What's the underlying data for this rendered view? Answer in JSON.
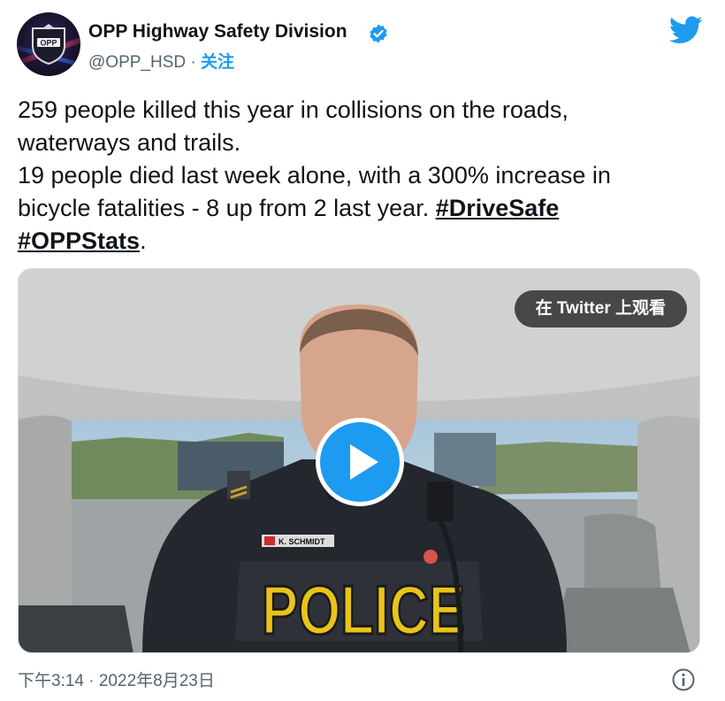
{
  "author": {
    "name": "OPP Highway Safety Division",
    "handle": "@OPP_HSD",
    "separator": "·",
    "follow_label": "关注",
    "avatar_text": "OPP"
  },
  "tweet": {
    "lines": [
      "259 people killed this year in collisions on the roads,",
      "waterways and trails.",
      "19 people died last week alone, with a 300% increase in",
      "bicycle fatalities - 8 up from 2 last year. "
    ],
    "hashtags": [
      "#DriveSafe",
      "#OPPStats"
    ],
    "trailing_period": "."
  },
  "media": {
    "watch_label": "在 Twitter 上观看",
    "nametag": "K. SCHMIDT",
    "vest_text": "POLICE"
  },
  "footer": {
    "timestamp": "下午3:14 · 2022年8月23日"
  },
  "colors": {
    "accent": "#1d9bf0",
    "secondary_text": "#536471",
    "primary_text": "#0f1419"
  },
  "icons": {
    "verified": "verified-badge-icon",
    "logo": "twitter-bird-icon",
    "play": "play-icon",
    "info": "info-icon"
  }
}
